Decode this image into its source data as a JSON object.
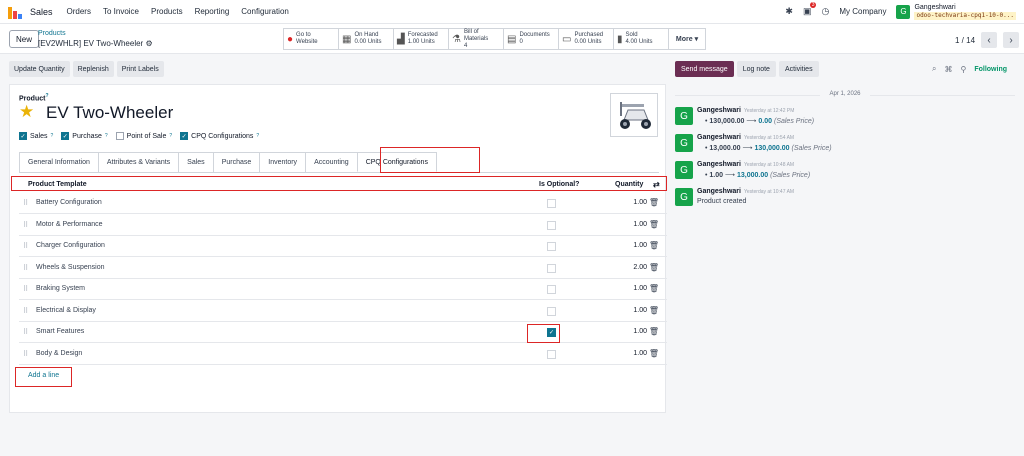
{
  "nav": {
    "app": "Sales",
    "menu": [
      "Orders",
      "To Invoice",
      "Products",
      "Reporting",
      "Configuration"
    ],
    "notif_count": "3",
    "company": "My Company",
    "user_initial": "G",
    "user_name": "Gangeshwari",
    "db_name": "odoo-techvaria-cpq1-10-0..."
  },
  "control": {
    "new_label": "New",
    "breadcrumb_parent": "Products",
    "record_title": "[EV2WHLR] EV Two-Wheeler",
    "smart_buttons": [
      {
        "l1": "Go to",
        "l2": "Website",
        "icon": "globe-icon"
      },
      {
        "l1": "On Hand",
        "l2": "0.00 Units",
        "icon": "cubes-icon"
      },
      {
        "l1": "Forecasted",
        "l2": "1.00 Units",
        "icon": "chart-icon"
      },
      {
        "l1": "Bill of Materials",
        "l2": "4",
        "icon": "flask-icon"
      },
      {
        "l1": "Documents",
        "l2": "0",
        "icon": "file-icon"
      },
      {
        "l1": "Purchased",
        "l2": "0.00 Units",
        "icon": "card-icon"
      },
      {
        "l1": "Sold",
        "l2": "4.00 Units",
        "icon": "signal-icon"
      }
    ],
    "more_label": "More",
    "pager": "1 / 14"
  },
  "actions": [
    "Update Quantity",
    "Replenish",
    "Print Labels"
  ],
  "form": {
    "product_label": "Product",
    "product_name": "EV Two-Wheeler",
    "flags": [
      {
        "label": "Sales",
        "checked": true
      },
      {
        "label": "Purchase",
        "checked": true
      },
      {
        "label": "Point of Sale",
        "checked": false
      },
      {
        "label": "CPQ Configurations",
        "checked": true
      }
    ],
    "tabs": [
      "General Information",
      "Attributes & Variants",
      "Sales",
      "Purchase",
      "Inventory",
      "Accounting",
      "CPQ Configurations"
    ],
    "active_tab": "CPQ Configurations",
    "columns": {
      "template": "Product Template",
      "optional": "Is Optional?",
      "quantity": "Quantity"
    },
    "lines": [
      {
        "name": "Battery Configuration",
        "optional": false,
        "qty": "1.00"
      },
      {
        "name": "Motor & Performance",
        "optional": false,
        "qty": "1.00"
      },
      {
        "name": "Charger Configuration",
        "optional": false,
        "qty": "1.00"
      },
      {
        "name": "Wheels & Suspension",
        "optional": false,
        "qty": "2.00"
      },
      {
        "name": "Braking System",
        "optional": false,
        "qty": "1.00"
      },
      {
        "name": "Electrical & Display",
        "optional": false,
        "qty": "1.00"
      },
      {
        "name": "Smart Features",
        "optional": true,
        "qty": "1.00"
      },
      {
        "name": "Body & Design",
        "optional": false,
        "qty": "1.00"
      }
    ],
    "add_line": "Add a line"
  },
  "chatter": {
    "send": "Send message",
    "log": "Log note",
    "activities": "Activities",
    "following": "Following",
    "date": "Apr 1, 2026",
    "messages": [
      {
        "author": "Gangeshwari",
        "time": "Yesterday at 12:42 PM",
        "old": "130,000.00",
        "new": "0.00",
        "field": "(Sales Price)"
      },
      {
        "author": "Gangeshwari",
        "time": "Yesterday at 10:54 AM",
        "old": "13,000.00",
        "new": "130,000.00",
        "field": "(Sales Price)"
      },
      {
        "author": "Gangeshwari",
        "time": "Yesterday at 10:48 AM",
        "old": "1.00",
        "new": "13,000.00",
        "field": "(Sales Price)"
      },
      {
        "author": "Gangeshwari",
        "time": "Yesterday at 10:47 AM",
        "text": "Product created"
      }
    ]
  },
  "colors": {
    "accent": "#0e7490",
    "brand": "#6b2e53",
    "highlight": "#dc2626"
  }
}
